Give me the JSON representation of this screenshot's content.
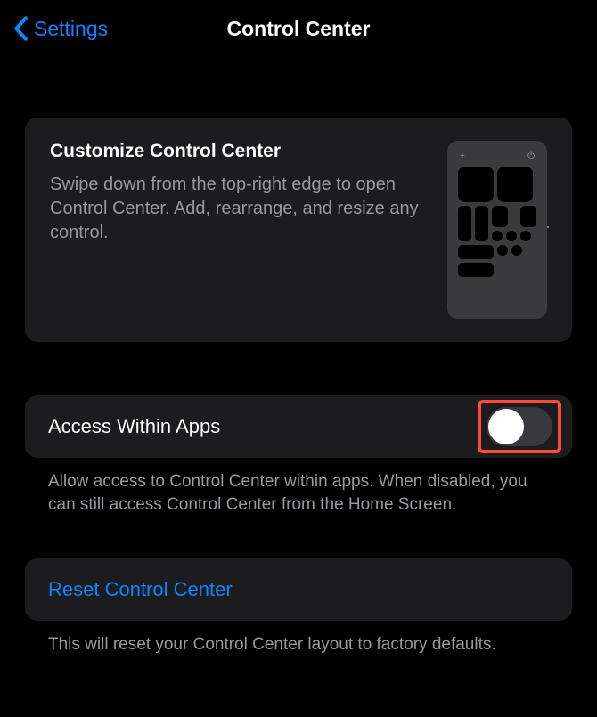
{
  "nav": {
    "back_label": "Settings",
    "title": "Control Center"
  },
  "customize_card": {
    "title": "Customize Control Center",
    "description": "Swipe down from the top-right edge to open Control Center. Add, rearrange, and resize any control."
  },
  "access_row": {
    "label": "Access Within Apps",
    "toggle_state": "off",
    "footer": "Allow access to Control Center within apps. When disabled, you can still access Control Center from the Home Screen."
  },
  "reset_row": {
    "label": "Reset Control Center",
    "footer": "This will reset your Control Center layout to factory defaults."
  }
}
